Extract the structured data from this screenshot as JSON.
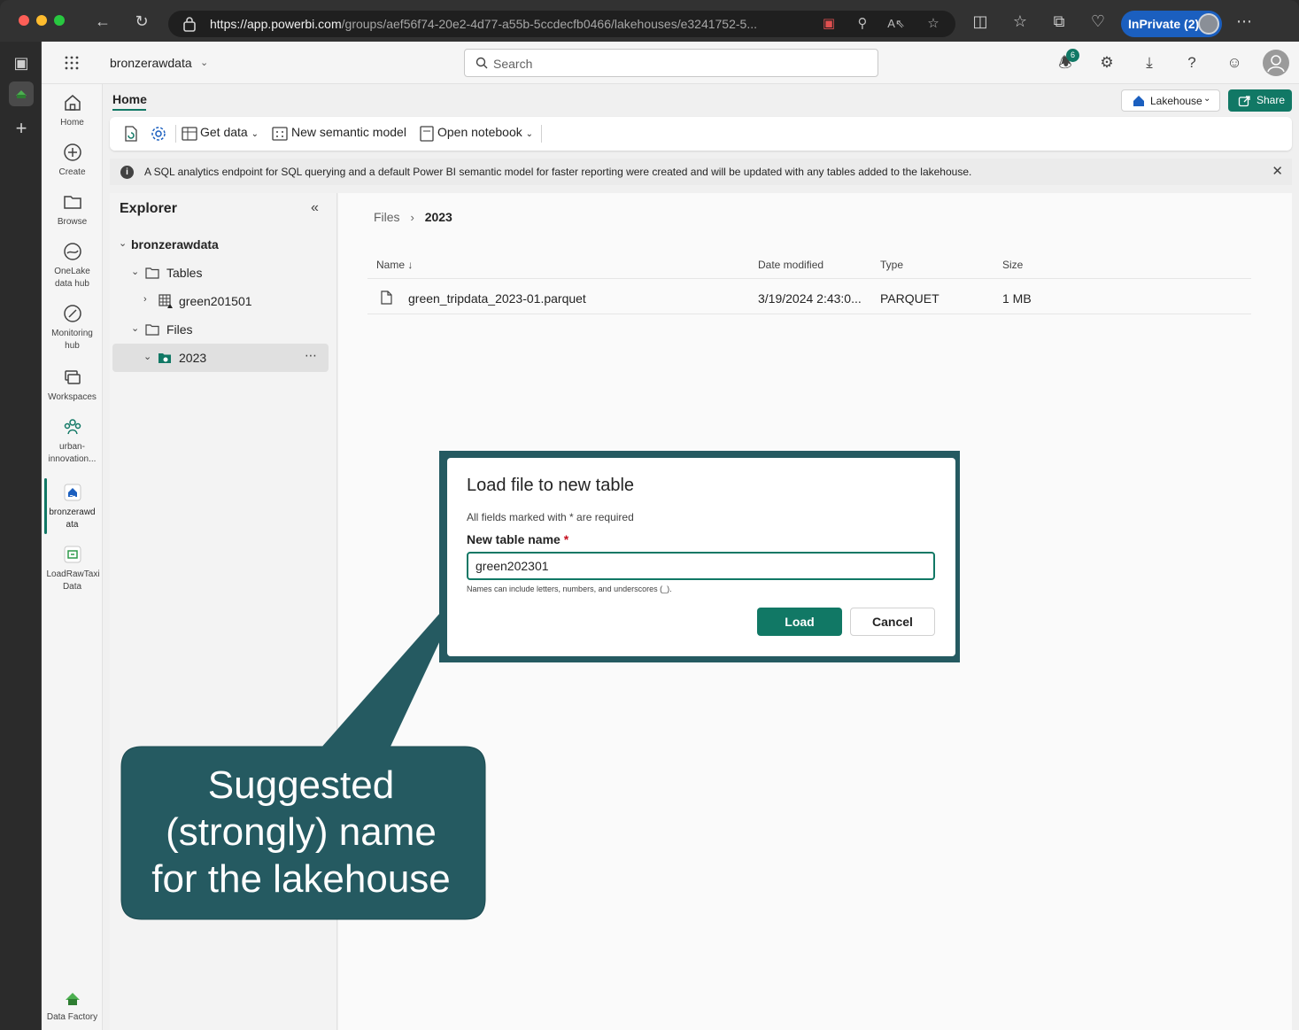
{
  "browser": {
    "url_host": "https://app.powerbi.com",
    "url_path": "/groups/aef56f74-20e2-4d77-a55b-5ccdecfb0466/lakehouses/e3241752-5...",
    "inprivate_label": "InPrivate (2)"
  },
  "topbar": {
    "workspace_name": "bronzerawdata",
    "search_placeholder": "Search",
    "notification_count": "6"
  },
  "nav": {
    "items": [
      {
        "label": "Home",
        "icon": "home-icon"
      },
      {
        "label": "Create",
        "icon": "create-icon"
      },
      {
        "label": "Browse",
        "icon": "browse-icon"
      },
      {
        "label": "OneLake data hub",
        "icon": "onelake-icon"
      },
      {
        "label": "Monitoring hub",
        "icon": "monitoring-icon"
      },
      {
        "label": "Workspaces",
        "icon": "workspaces-icon"
      },
      {
        "label": "urban-innovation...",
        "icon": "workspace-people-icon"
      },
      {
        "label": "bronzerawd ata",
        "icon": "lakehouse-icon"
      },
      {
        "label": "LoadRawTaxi Data",
        "icon": "pipeline-icon"
      }
    ],
    "footer_label": "Data Factory"
  },
  "header": {
    "tab": "Home",
    "lakehouse_button": "Lakehouse",
    "share_button": "Share"
  },
  "ribbon": {
    "get_data": "Get data",
    "new_semantic_model": "New semantic model",
    "open_notebook": "Open notebook"
  },
  "info_banner": "A SQL analytics endpoint for SQL querying and a default Power BI semantic model for faster reporting were created and will be updated with any tables added to the lakehouse.",
  "explorer": {
    "title": "Explorer",
    "root": "bronzerawdata",
    "tables_label": "Tables",
    "table_item": "green201501",
    "files_label": "Files",
    "folder_item": "2023"
  },
  "files_view": {
    "breadcrumb_root": "Files",
    "breadcrumb_current": "2023",
    "columns": [
      "Name",
      "Date modified",
      "Type",
      "Size"
    ],
    "rows": [
      {
        "name": "green_tripdata_2023-01.parquet",
        "date_modified": "3/19/2024 2:43:0...",
        "type": "PARQUET",
        "size": "1 MB"
      }
    ]
  },
  "dialog": {
    "title": "Load file to new table",
    "required_note": "All fields marked with * are required",
    "field_label": "New table name",
    "field_value": "green202301",
    "hint": "Names can include letters, numbers, and underscores (_).",
    "load_button": "Load",
    "cancel_button": "Cancel"
  },
  "callout": {
    "line1": "Suggested",
    "line2": "(strongly) name",
    "line3": "for the lakehouse",
    "color": "#255a61"
  },
  "colors": {
    "accent": "#117865",
    "inprivate": "#1b5fbf"
  }
}
